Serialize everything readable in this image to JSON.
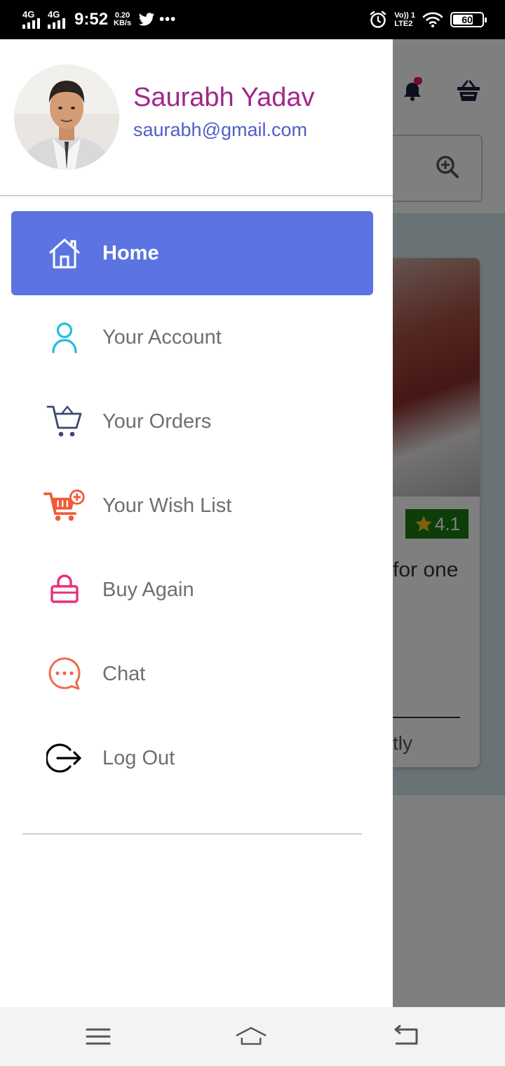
{
  "status_bar": {
    "network1": "4G",
    "network2": "4G",
    "time": "9:52",
    "speed_value": "0.20",
    "speed_unit": "KB/s",
    "more_dots": "•••",
    "volte_top": "Vo)) 1",
    "volte_bottom": "LTE2",
    "battery": "60"
  },
  "drawer": {
    "user": {
      "name": "Saurabh Yadav",
      "email": "saurabh@gmail.com"
    },
    "menu": [
      {
        "label": "Home",
        "icon": "home-icon",
        "active": true
      },
      {
        "label": "Your Account",
        "icon": "account-icon",
        "active": false
      },
      {
        "label": "Your Orders",
        "icon": "cart-icon",
        "active": false
      },
      {
        "label": "Your Wish List",
        "icon": "wishlist-cart-icon",
        "active": false
      },
      {
        "label": "Buy Again",
        "icon": "bag-icon",
        "active": false
      },
      {
        "label": "Chat",
        "icon": "chat-icon",
        "active": false
      },
      {
        "label": "Log Out",
        "icon": "logout-icon",
        "active": false
      }
    ]
  },
  "background_app": {
    "rating": "4.1",
    "text_fragment_1": "for one",
    "text_fragment_2": "tly"
  },
  "colors": {
    "active_item": "#5c74e2",
    "user_name": "#a2278a",
    "user_email": "#4f5fc6",
    "rating_badge": "#1b7a13"
  },
  "nav_bar": {
    "icons": [
      "menu-icon",
      "home-icon",
      "back-icon"
    ]
  }
}
